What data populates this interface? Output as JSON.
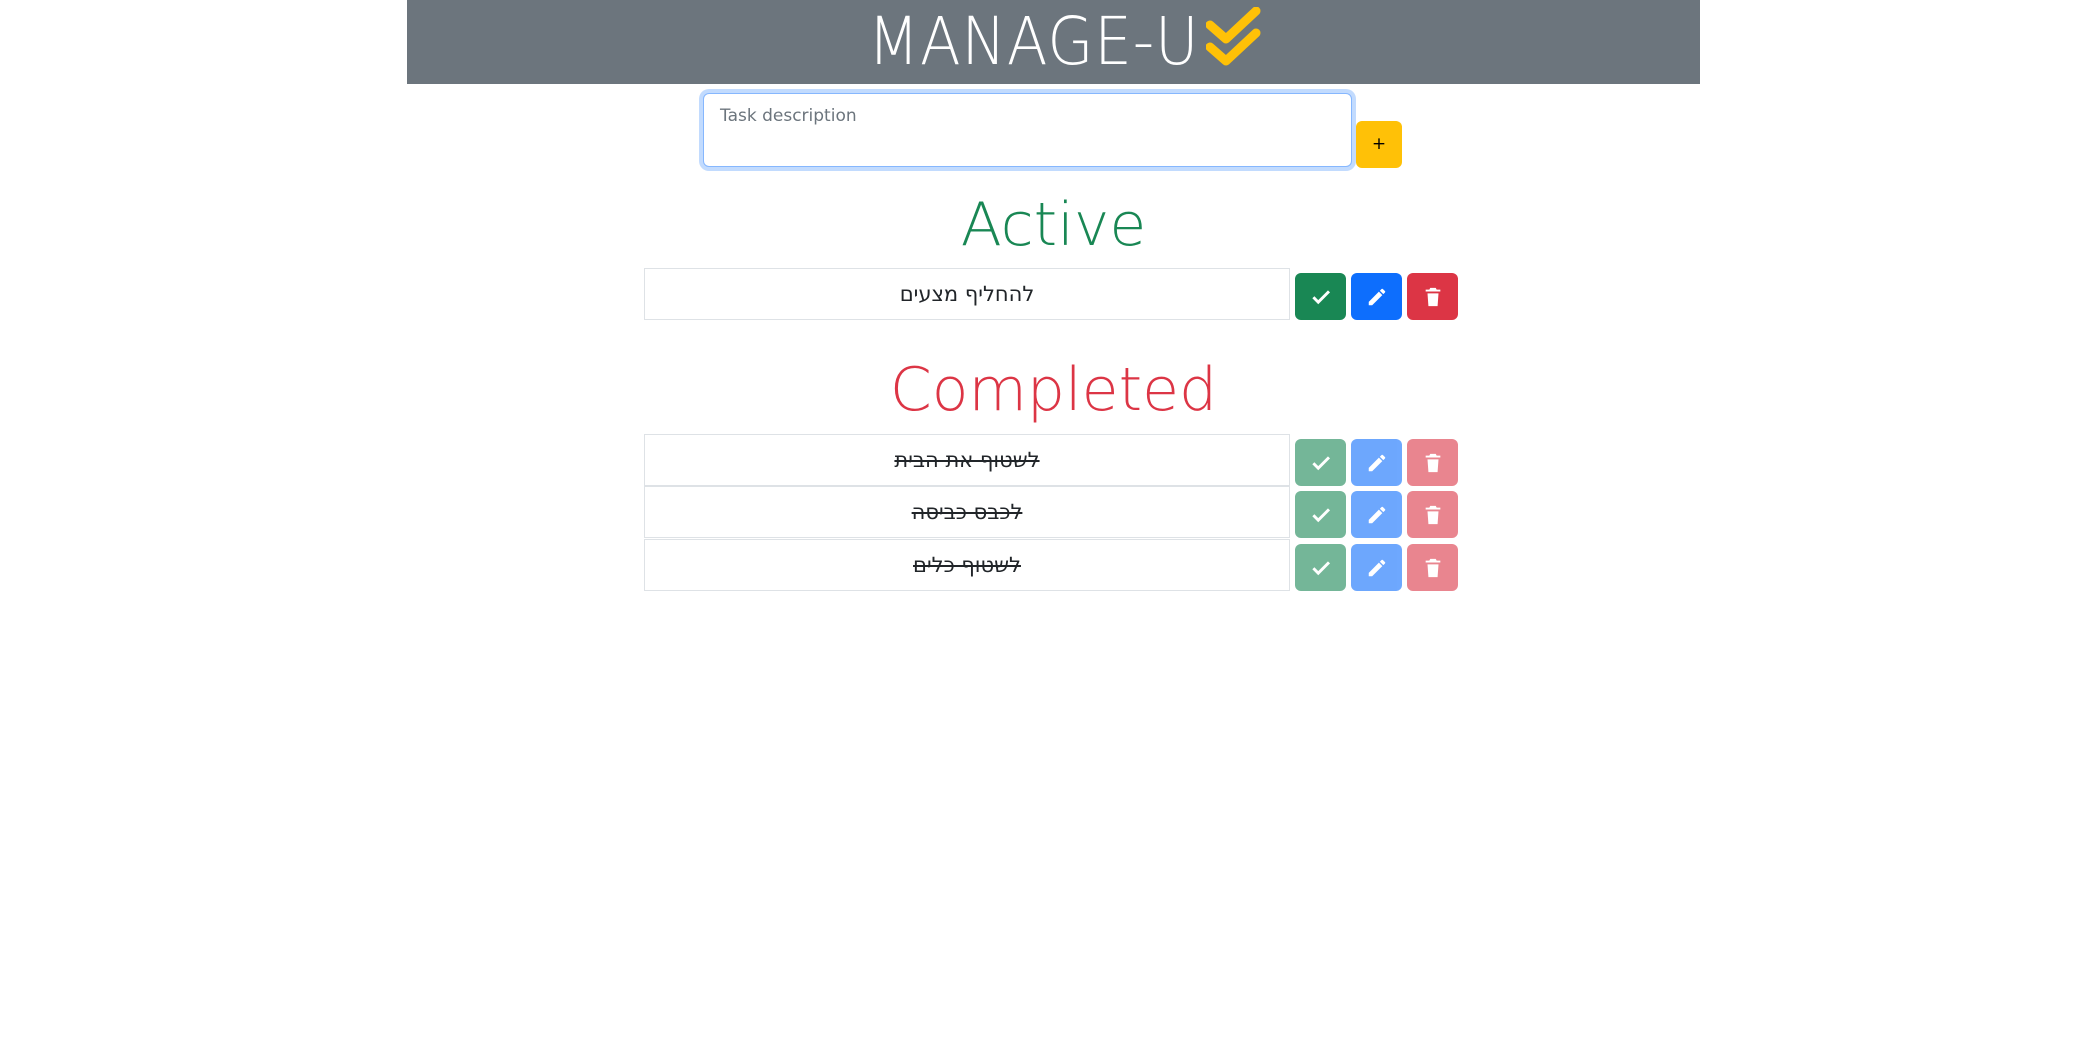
{
  "header": {
    "title": "MANAGE-U",
    "icon": "double-check-icon",
    "accent_color": "#ffc107",
    "background_color": "#6c757d"
  },
  "new_task": {
    "placeholder": "Task description",
    "value": "",
    "add_label": "+"
  },
  "active": {
    "heading": "Active",
    "color": "#198754",
    "tasks": [
      {
        "text": "להחליף מצעים"
      }
    ]
  },
  "completed": {
    "heading": "Completed",
    "color": "#dc3545",
    "tasks": [
      {
        "text": "לשטוף את הבית"
      },
      {
        "text": "לכבס כביסה"
      },
      {
        "text": "לשטוף כלים"
      }
    ]
  },
  "task_actions": {
    "complete_icon": "check-icon",
    "edit_icon": "pencil-icon",
    "delete_icon": "trash-icon"
  }
}
